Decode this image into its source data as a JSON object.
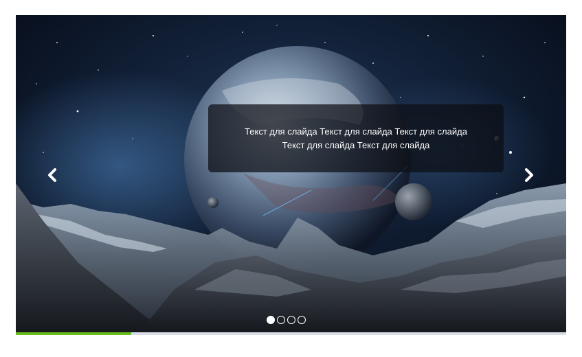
{
  "slider": {
    "caption_line1": "Текст для слайда Текст для слайда Текст для слайда",
    "caption_line2": "Текст для слайда Текст для слайда",
    "prev_icon": "chevron-left-icon",
    "next_icon": "chevron-right-icon",
    "dots": [
      {
        "active": true
      },
      {
        "active": false
      },
      {
        "active": false
      },
      {
        "active": false
      }
    ],
    "current_slide": 1,
    "total_slides": 4,
    "progress_fraction": 0.21
  },
  "colors": {
    "caption_bg": "#0c0e14",
    "progress_fill": "#6bbd1f",
    "progress_track": "#d9dde6",
    "sky": "#0a1020"
  }
}
